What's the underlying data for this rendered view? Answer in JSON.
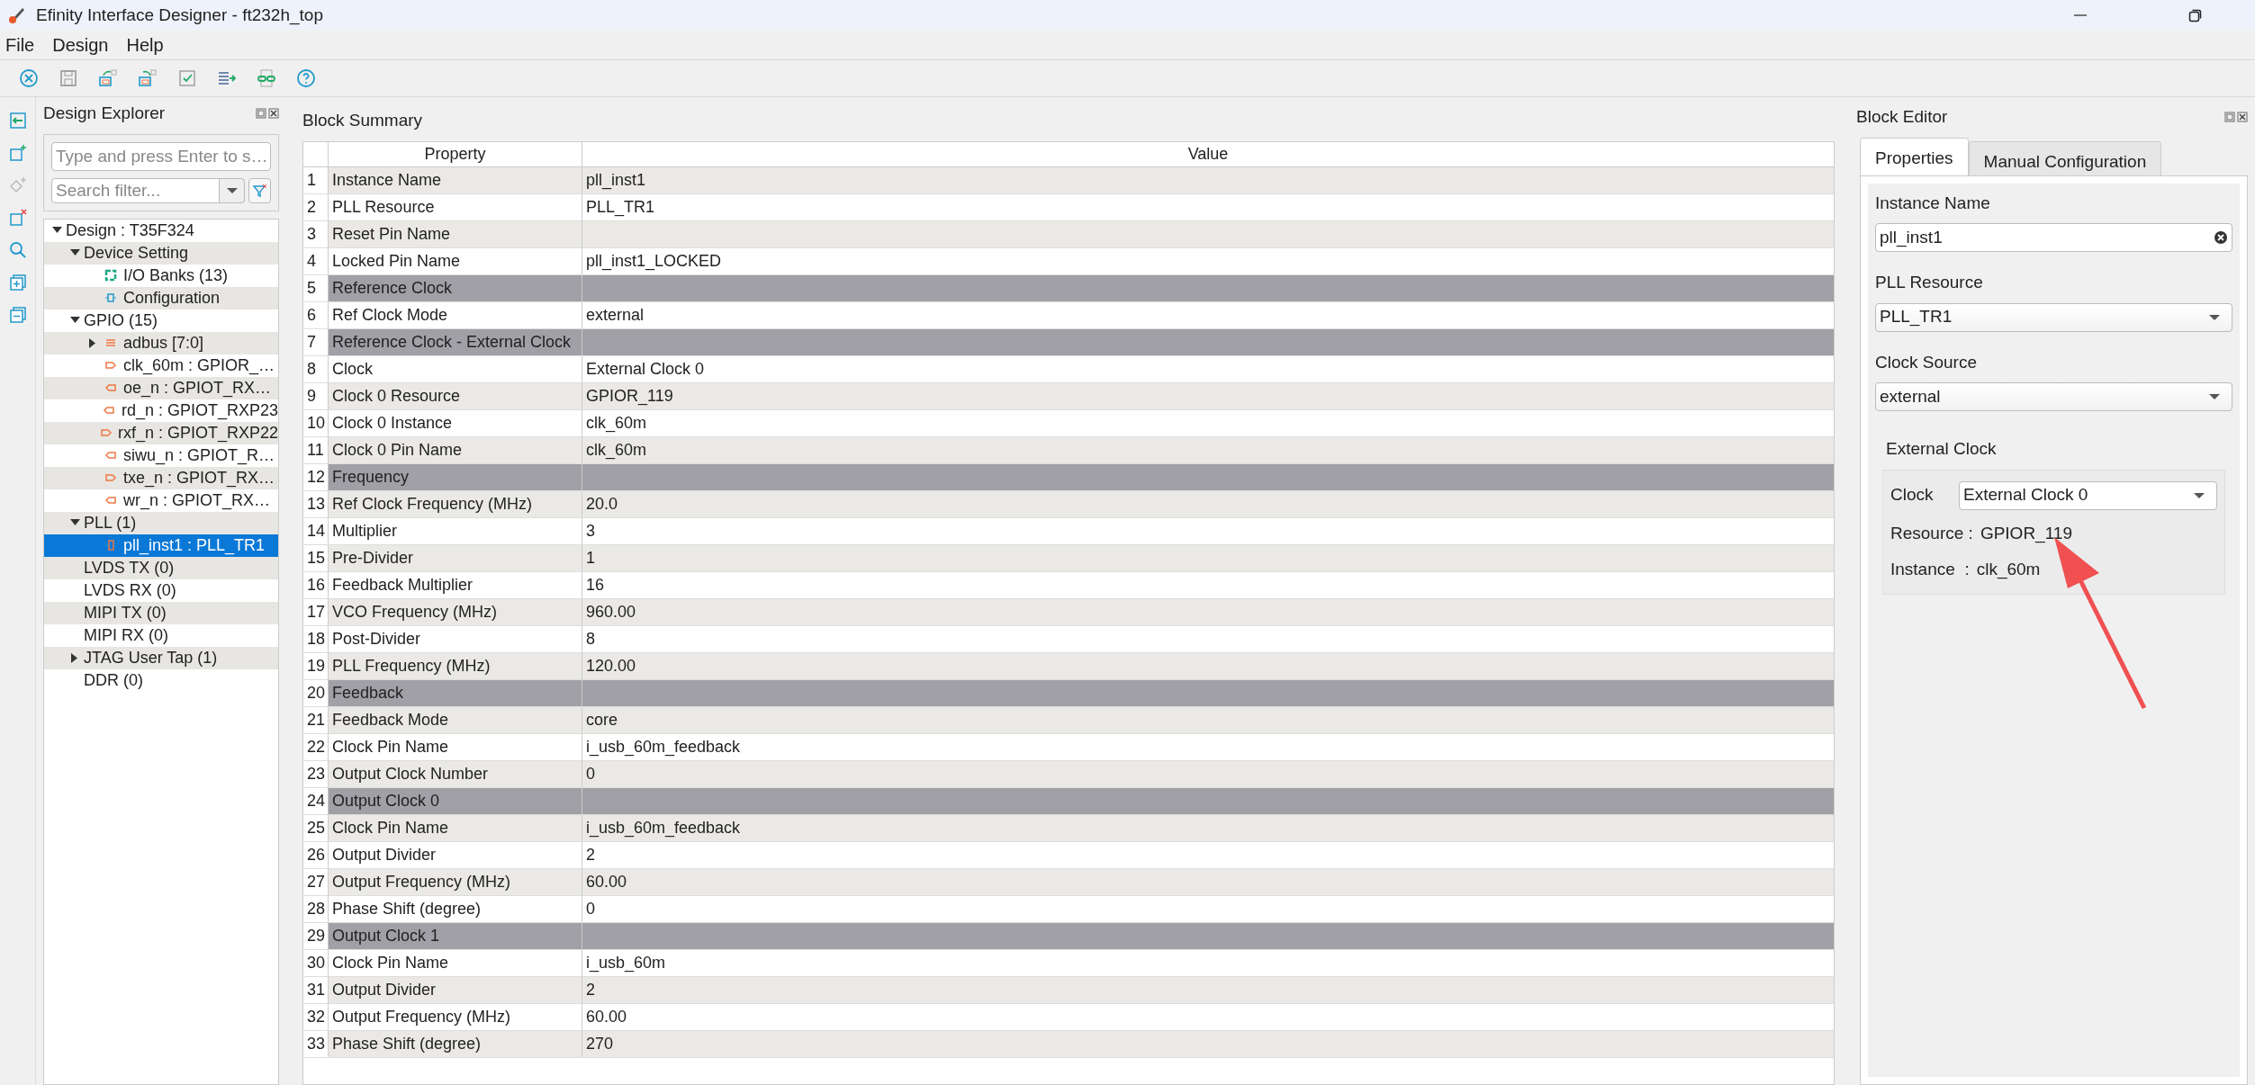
{
  "window": {
    "title": "Efinity Interface Designer - ft232h_top"
  },
  "menu": [
    "File",
    "Design",
    "Help"
  ],
  "design_explorer": {
    "title": "Design Explorer",
    "search_placeholder": "Type and press Enter to s…",
    "filter_placeholder": "Search filter...",
    "tree": [
      {
        "label": "Design : T35F324",
        "expanded": true,
        "selected": false,
        "children": [
          {
            "label": "Device Setting",
            "expanded": true,
            "selected": false,
            "children": [
              {
                "label": "I/O Banks (13)",
                "kind": "bank",
                "selected": false
              },
              {
                "label": "Configuration",
                "kind": "config",
                "selected": false
              }
            ]
          },
          {
            "label": "GPIO (15)",
            "expanded": true,
            "selected": false,
            "children": [
              {
                "label": "adbus [7:0]",
                "kind": "bus",
                "expanded": false,
                "selected": false
              },
              {
                "label": "clk_60m : GPIOR_…",
                "kind": "output",
                "selected": false
              },
              {
                "label": "oe_n : GPIOT_RX…",
                "kind": "input",
                "selected": false
              },
              {
                "label": "rd_n : GPIOT_RXP23",
                "kind": "input",
                "selected": false
              },
              {
                "label": "rxf_n : GPIOT_RXP22",
                "kind": "output",
                "selected": false
              },
              {
                "label": "siwu_n : GPIOT_R…",
                "kind": "input",
                "selected": false
              },
              {
                "label": "txe_n : GPIOT_RX…",
                "kind": "output",
                "selected": false
              },
              {
                "label": "wr_n : GPIOT_RX…",
                "kind": "input",
                "selected": false
              }
            ]
          },
          {
            "label": "PLL (1)",
            "expanded": true,
            "selected": false,
            "children": [
              {
                "label": "pll_inst1 : PLL_TR1",
                "kind": "pll",
                "selected": true
              }
            ]
          },
          {
            "label": "LVDS TX (0)",
            "selected": false
          },
          {
            "label": "LVDS RX (0)",
            "selected": false
          },
          {
            "label": "MIPI TX (0)",
            "selected": false
          },
          {
            "label": "MIPI RX (0)",
            "selected": false
          },
          {
            "label": "JTAG User Tap (1)",
            "expanded": false,
            "selected": false
          },
          {
            "label": "DDR (0)",
            "selected": false
          }
        ]
      }
    ]
  },
  "block_summary": {
    "title": "Block Summary",
    "columns": [
      "Property",
      "Value"
    ],
    "rows": [
      {
        "index": "1",
        "property": "Instance Name",
        "value": "pll_inst1",
        "kind": "item"
      },
      {
        "index": "2",
        "property": "PLL Resource",
        "value": "PLL_TR1",
        "kind": "item"
      },
      {
        "index": "3",
        "property": "Reset Pin Name",
        "kind": "item"
      },
      {
        "index": "4",
        "property": "Locked Pin Name",
        "value": "pll_inst1_LOCKED",
        "kind": "item"
      },
      {
        "index": "5",
        "property": "Reference Clock",
        "kind": "section"
      },
      {
        "index": "6",
        "property": "Ref Clock Mode",
        "value": "external",
        "kind": "item"
      },
      {
        "index": "7",
        "property": "Reference Clock - External Clock",
        "kind": "section"
      },
      {
        "index": "8",
        "property": "Clock",
        "value": "External Clock 0",
        "kind": "item"
      },
      {
        "index": "9",
        "property": "Clock 0 Resource",
        "value": "GPIOR_119",
        "kind": "item"
      },
      {
        "index": "10",
        "property": "Clock 0 Instance",
        "value": "clk_60m",
        "kind": "item"
      },
      {
        "index": "11",
        "property": "Clock 0 Pin Name",
        "value": "clk_60m",
        "kind": "item"
      },
      {
        "index": "12",
        "property": "Frequency",
        "kind": "section"
      },
      {
        "index": "13",
        "property": "Ref Clock Frequency (MHz)",
        "value": "20.0",
        "kind": "item"
      },
      {
        "index": "14",
        "property": "Multiplier",
        "value": "3",
        "kind": "item"
      },
      {
        "index": "15",
        "property": "Pre-Divider",
        "value": "1",
        "kind": "item"
      },
      {
        "index": "16",
        "property": "Feedback Multiplier",
        "value": "16",
        "kind": "item"
      },
      {
        "index": "17",
        "property": "VCO Frequency (MHz)",
        "value": "960.00",
        "kind": "item"
      },
      {
        "index": "18",
        "property": "Post-Divider",
        "value": "8",
        "kind": "item"
      },
      {
        "index": "19",
        "property": "PLL Frequency (MHz)",
        "value": "120.00",
        "kind": "item"
      },
      {
        "index": "20",
        "property": "Feedback",
        "kind": "section"
      },
      {
        "index": "21",
        "property": "Feedback Mode",
        "value": "core",
        "kind": "item"
      },
      {
        "index": "22",
        "property": "Clock Pin Name",
        "value": "i_usb_60m_feedback",
        "kind": "item"
      },
      {
        "index": "23",
        "property": "Output Clock Number",
        "value": "0",
        "kind": "item"
      },
      {
        "index": "24",
        "property": "Output Clock 0",
        "kind": "section"
      },
      {
        "index": "25",
        "property": "Clock Pin Name",
        "value": "i_usb_60m_feedback",
        "kind": "item"
      },
      {
        "index": "26",
        "property": "Output Divider",
        "value": "2",
        "kind": "item"
      },
      {
        "index": "27",
        "property": "Output Frequency (MHz)",
        "value": "60.00",
        "kind": "item"
      },
      {
        "index": "28",
        "property": "Phase Shift (degree)",
        "value": "0",
        "kind": "item"
      },
      {
        "index": "29",
        "property": "Output Clock 1",
        "kind": "section"
      },
      {
        "index": "30",
        "property": "Clock Pin Name",
        "value": "i_usb_60m",
        "kind": "item"
      },
      {
        "index": "31",
        "property": "Output Divider",
        "value": "2",
        "kind": "item"
      },
      {
        "index": "32",
        "property": "Output Frequency (MHz)",
        "value": "60.00",
        "kind": "item"
      },
      {
        "index": "33",
        "property": "Phase Shift (degree)",
        "value": "270",
        "kind": "item"
      }
    ]
  },
  "block_editor": {
    "title": "Block Editor",
    "tabs": [
      {
        "label": "Properties",
        "selected": true
      },
      {
        "label": "Manual Configuration",
        "selected": false
      }
    ],
    "fields": [
      {
        "label": "Instance Name",
        "value": "pll_inst1",
        "kind": "text"
      },
      {
        "label": "PLL Resource",
        "value": "PLL_TR1",
        "kind": "select"
      },
      {
        "label": "Clock Source",
        "value": "external",
        "kind": "select"
      }
    ],
    "group": {
      "title": "External Clock",
      "clock_label": "Clock",
      "clock_value": "External Clock 0",
      "resource_label": "Resource :",
      "resource_value": "GPIOR_119",
      "instance_label": "Instance  :",
      "instance_value": "clk_60m"
    }
  }
}
